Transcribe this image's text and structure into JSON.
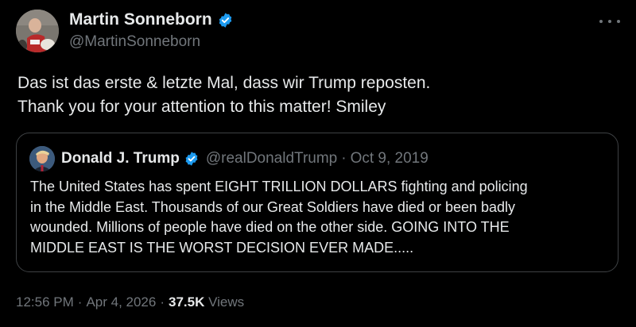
{
  "author": {
    "name": "Martin Sonneborn",
    "handle": "@MartinSonneborn",
    "verified_color": "#1d9bf0"
  },
  "tweet": {
    "lines": [
      "Das ist das erste & letzte Mal, dass wir Trump reposten.",
      "Thank you for your attention to this matter! Smiley"
    ]
  },
  "quoted": {
    "name": "Donald J. Trump",
    "handle": "@realDonaldTrump",
    "separator": "·",
    "date": "Oct 9, 2019",
    "lines": [
      "The United States has spent EIGHT TRILLION DOLLARS fighting and policing",
      "in the Middle East. Thousands of our Great Soldiers have died or been badly",
      "wounded. Millions of people have died on the other side. GOING INTO THE",
      "MIDDLE EAST IS THE WORST DECISION EVER MADE....."
    ]
  },
  "meta": {
    "time": "12:56 PM",
    "date": "Apr 4, 2026",
    "separator": "·",
    "views_count": "37.5K",
    "views_label": "Views"
  },
  "icons": {
    "more": "more-options-icon",
    "verified": "verified-badge-icon"
  },
  "colors": {
    "background": "#000000",
    "text_primary": "#e7e9ea",
    "text_secondary": "#71767b",
    "border": "#3e4144",
    "verified": "#1d9bf0"
  }
}
